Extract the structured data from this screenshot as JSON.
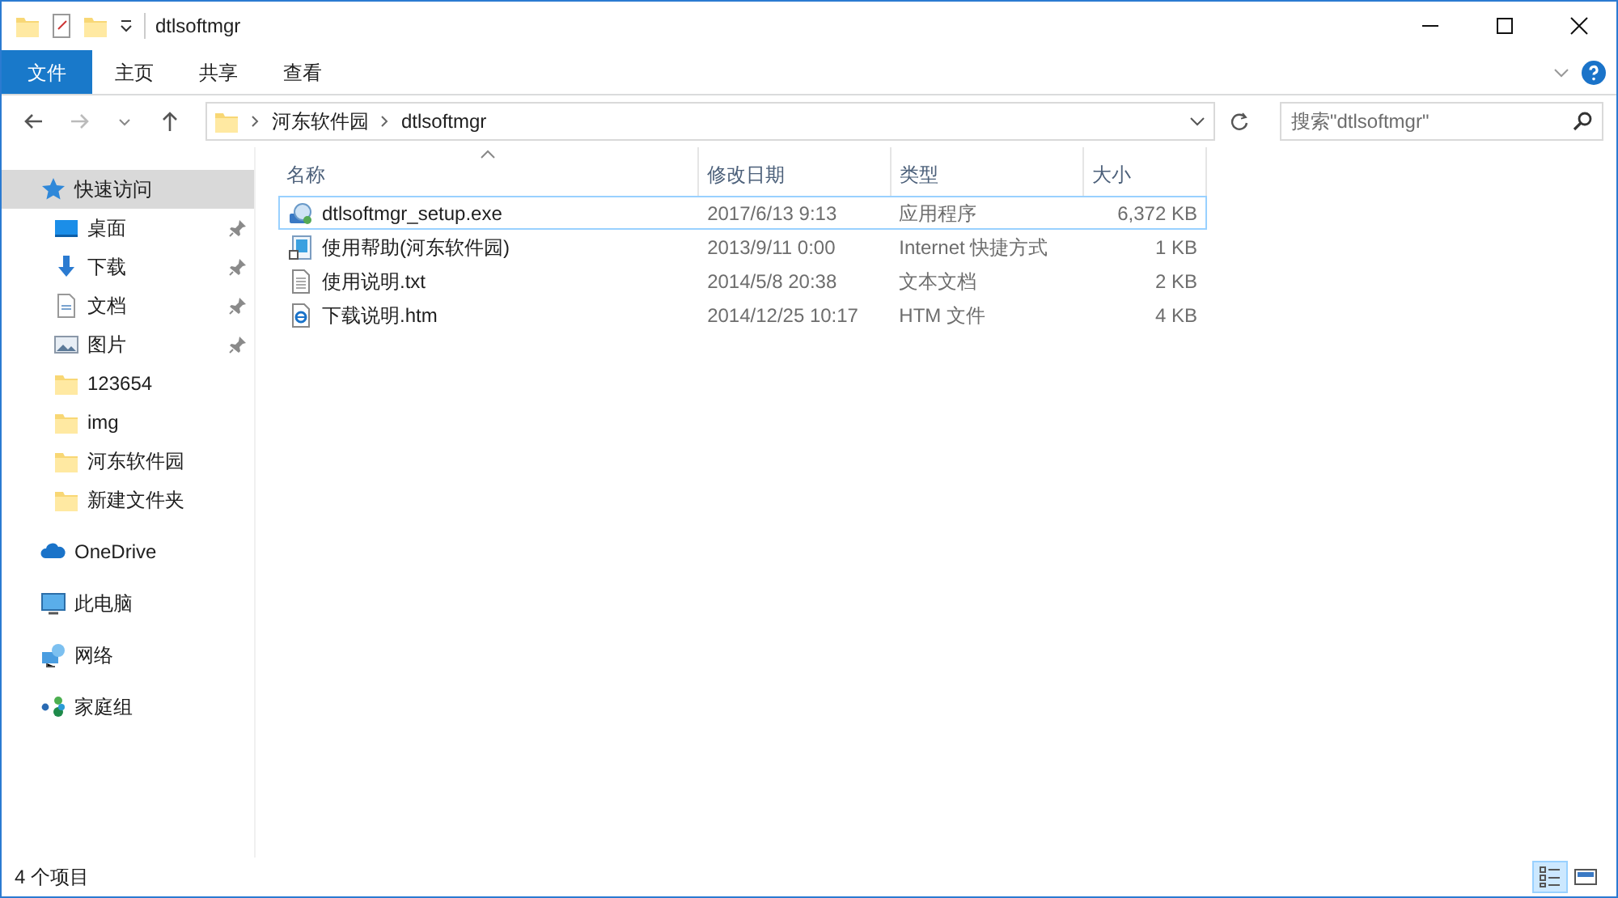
{
  "window": {
    "title": "dtlsoftmgr"
  },
  "ribbon_tabs": [
    {
      "label": "文件",
      "kind": "file",
      "selected": false
    },
    {
      "label": "主页",
      "kind": "tab",
      "selected": false
    },
    {
      "label": "共享",
      "kind": "tab",
      "selected": false
    },
    {
      "label": "查看",
      "kind": "tab",
      "selected": false
    }
  ],
  "address_bar": {
    "breadcrumbs": [
      "河东软件园",
      "dtlsoftmgr"
    ]
  },
  "search": {
    "placeholder": "搜索\"dtlsoftmgr\""
  },
  "sidebar": {
    "items": [
      {
        "label": "快速访问",
        "kind": "star",
        "selected": true,
        "children": [
          {
            "label": "桌面",
            "kind": "desktop",
            "pinned": true,
            "selected": false
          },
          {
            "label": "下载",
            "kind": "download",
            "pinned": true,
            "selected": false
          },
          {
            "label": "文档",
            "kind": "document",
            "pinned": true,
            "selected": false
          },
          {
            "label": "图片",
            "kind": "picture",
            "pinned": true,
            "selected": false
          },
          {
            "label": "123654",
            "kind": "folder",
            "pinned": false,
            "selected": false
          },
          {
            "label": "img",
            "kind": "folder",
            "pinned": false,
            "selected": false
          },
          {
            "label": "河东软件园",
            "kind": "folder",
            "pinned": false,
            "selected": false
          },
          {
            "label": "新建文件夹",
            "kind": "folder",
            "pinned": false,
            "selected": false
          }
        ]
      },
      {
        "label": "OneDrive",
        "kind": "cloud",
        "selected": false
      },
      {
        "label": "此电脑",
        "kind": "pc",
        "selected": false
      },
      {
        "label": "网络",
        "kind": "network",
        "selected": false
      },
      {
        "label": "家庭组",
        "kind": "homegroup",
        "selected": false
      }
    ]
  },
  "table": {
    "columns": [
      "名称",
      "修改日期",
      "类型",
      "大小"
    ],
    "rows": [
      {
        "kind": "exe",
        "focused": true,
        "cells": [
          "dtlsoftmgr_setup.exe",
          "2017/6/13 9:13",
          "应用程序",
          "6,372 KB"
        ]
      },
      {
        "kind": "url",
        "focused": false,
        "cells": [
          "使用帮助(河东软件园)",
          "2013/9/11 0:00",
          "Internet 快捷方式",
          "1 KB"
        ]
      },
      {
        "kind": "txt",
        "focused": false,
        "cells": [
          "使用说明.txt",
          "2014/5/8 20:38",
          "文本文档",
          "2 KB"
        ]
      },
      {
        "kind": "htm",
        "focused": false,
        "cells": [
          "下载说明.htm",
          "2014/12/25 10:17",
          "HTM 文件",
          "4 KB"
        ]
      }
    ]
  },
  "status_bar": {
    "text": "4 个项目",
    "views": [
      {
        "kind": "details",
        "selected": true
      },
      {
        "kind": "large-icons",
        "selected": false
      }
    ]
  }
}
